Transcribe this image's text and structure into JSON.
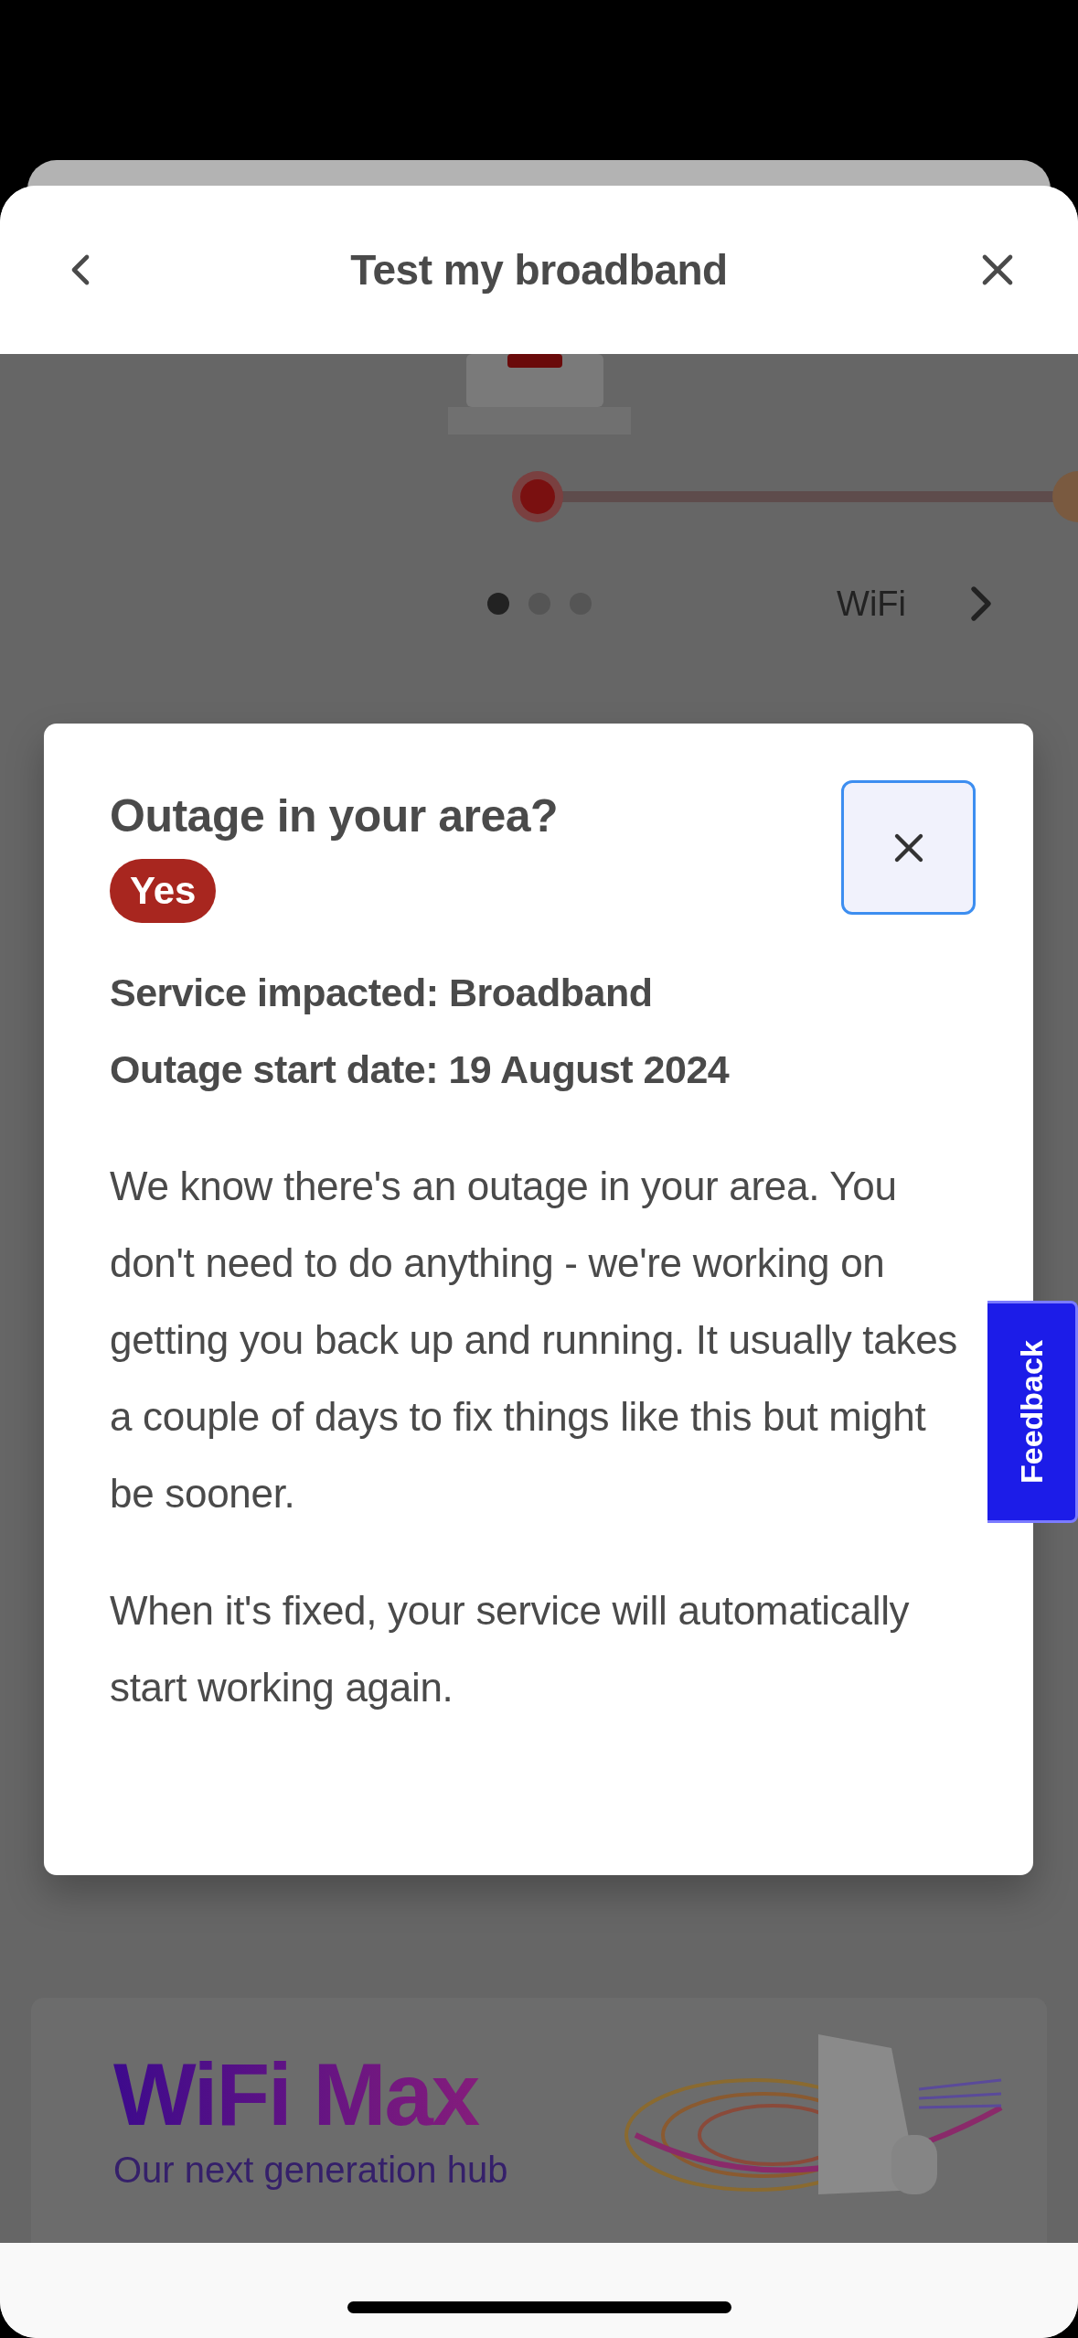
{
  "header": {
    "title": "Test my broadband"
  },
  "carousel": {
    "dots": [
      {
        "selected": true
      },
      {
        "selected": false
      },
      {
        "selected": false
      }
    ],
    "next_label": "WiFi"
  },
  "modal": {
    "title": "Outage in your area?",
    "status_badge": "Yes",
    "details": [
      "Service impacted: Broadband",
      "Outage start date: 19 August 2024"
    ],
    "paragraphs": [
      "We know there's an outage in your area. You don't need to do anything - we're working on getting you back up and running. It usually takes a couple of days to fix things like this but might be sooner.",
      "When it's fixed, your service will automatically start working again."
    ]
  },
  "feedback_tab": {
    "label": "Feedback"
  },
  "banner": {
    "title": "WiFi Max",
    "subtitle": "Our next generation hub"
  }
}
